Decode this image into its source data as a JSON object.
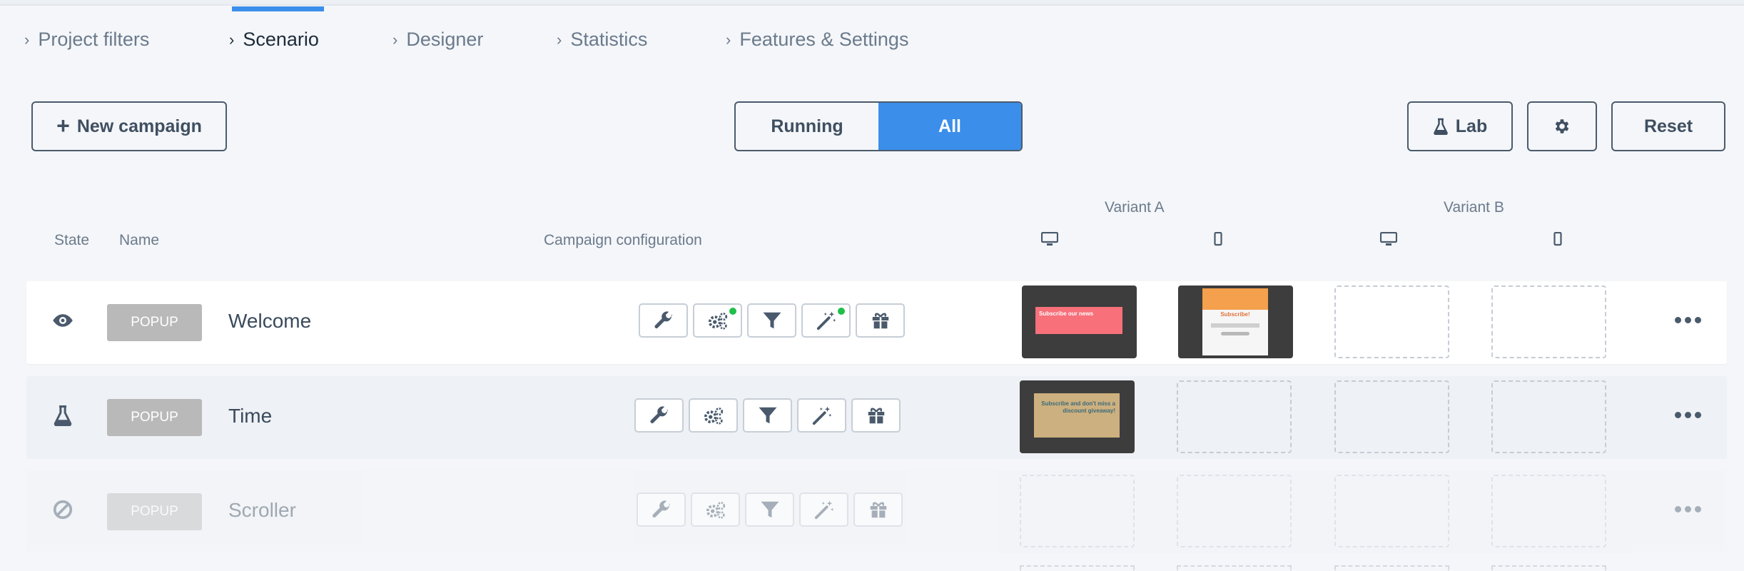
{
  "tabs": [
    {
      "label": "Project filters",
      "active": false
    },
    {
      "label": "Scenario",
      "active": true
    },
    {
      "label": "Designer",
      "active": false
    },
    {
      "label": "Statistics",
      "active": false
    },
    {
      "label": "Features & Settings",
      "active": false
    }
  ],
  "toolbar": {
    "new_campaign": "New campaign",
    "filter_running": "Running",
    "filter_all": "All",
    "filter_selected": "All",
    "lab": "Lab",
    "reset": "Reset"
  },
  "table": {
    "col_state": "State",
    "col_name": "Name",
    "col_config": "Campaign configuration",
    "variant_a": "Variant A",
    "variant_b": "Variant B"
  },
  "rows": [
    {
      "state": "eye-icon",
      "type": "POPUP",
      "name": "Welcome",
      "thumb_a_desktop_text": "Subscribe our news",
      "thumb_a_mobile_text": "Subscribe!"
    },
    {
      "state": "flask-icon",
      "type": "POPUP",
      "name": "Time",
      "thumb_a_desktop_text": "Subscribe and don't miss a discount giveaway!"
    },
    {
      "state": "ban-icon",
      "type": "POPUP",
      "name": "Scroller"
    }
  ],
  "colors": {
    "accent": "#3b8eea",
    "status_dot": "#1fbf4a",
    "badge": "#b9b9b9"
  }
}
